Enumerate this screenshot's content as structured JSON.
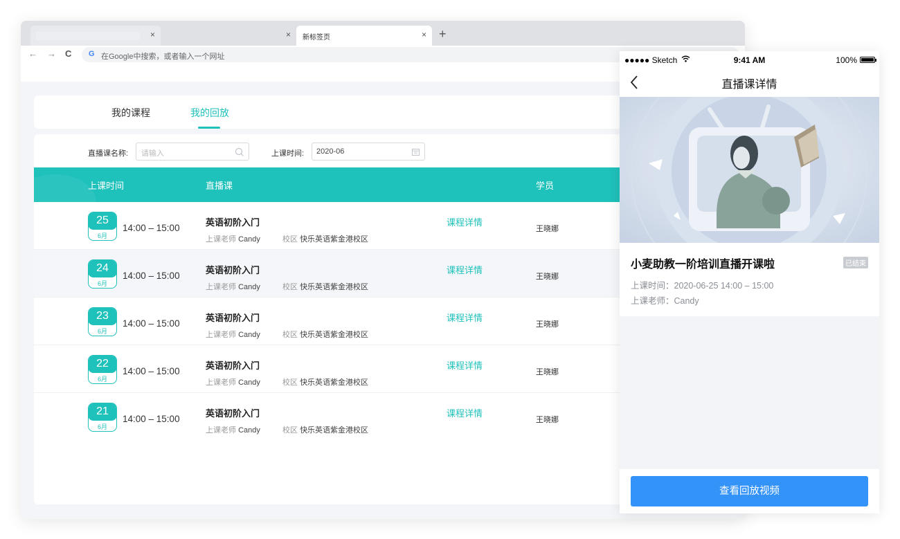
{
  "browser": {
    "tabs": [
      {
        "title": "",
        "close": "×"
      },
      {
        "title": "",
        "close": "×"
      },
      {
        "title": "新标签页",
        "close": "×"
      }
    ],
    "new_tab": "+",
    "nav": {
      "back": "←",
      "forward": "→",
      "reload": "C"
    },
    "omnibox": {
      "g_logo": "G",
      "placeholder": "在Google中搜索，或者输入一个网址"
    }
  },
  "subnav": {
    "tabs": [
      "我的课程",
      "我的回放"
    ],
    "active": "我的回放"
  },
  "filters": {
    "name_label": "直播课名称:",
    "name_placeholder": "请输入",
    "time_label": "上课时间:",
    "time_value": "2020-06"
  },
  "table": {
    "headers": [
      "上课时间",
      "直播课",
      "学员"
    ],
    "teacher_key": "上课老师",
    "campus_key": "校区",
    "rows": [
      {
        "day": "25",
        "month": "6月",
        "time": "14:00 – 15:00",
        "course": "英语初阶入门",
        "teacher": "Candy",
        "campus": "快乐英语紫金港校区",
        "detail": "课程详情",
        "student": "王晓娜"
      },
      {
        "day": "24",
        "month": "6月",
        "time": "14:00 – 15:00",
        "course": "英语初阶入门",
        "teacher": "Candy",
        "campus": "快乐英语紫金港校区",
        "detail": "课程详情",
        "student": "王晓娜"
      },
      {
        "day": "23",
        "month": "6月",
        "time": "14:00 – 15:00",
        "course": "英语初阶入门",
        "teacher": "Candy",
        "campus": "快乐英语紫金港校区",
        "detail": "课程详情",
        "student": "王晓娜"
      },
      {
        "day": "22",
        "month": "6月",
        "time": "14:00 – 15:00",
        "course": "英语初阶入门",
        "teacher": "Candy",
        "campus": "快乐英语紫金港校区",
        "detail": "课程详情",
        "student": "王晓娜"
      },
      {
        "day": "21",
        "month": "6月",
        "time": "14:00 – 15:00",
        "course": "英语初阶入门",
        "teacher": "Candy",
        "campus": "快乐英语紫金港校区",
        "detail": "课程详情",
        "student": "王晓娜"
      }
    ]
  },
  "phone": {
    "status": {
      "carrier": "●●●●● Sketch",
      "time": "9:41 AM",
      "battery": "100%"
    },
    "nav_title": "直播课详情",
    "course_title": "小麦助教一阶培训直播开课啦",
    "badge": "已结束",
    "time_line": "上课时间：2020-06-25  14:00 – 15:00",
    "teacher_line": "上课老师：Candy",
    "button": "查看回放视频"
  },
  "colors": {
    "accent": "#1fc1bb",
    "primary_button": "#3393f8"
  }
}
